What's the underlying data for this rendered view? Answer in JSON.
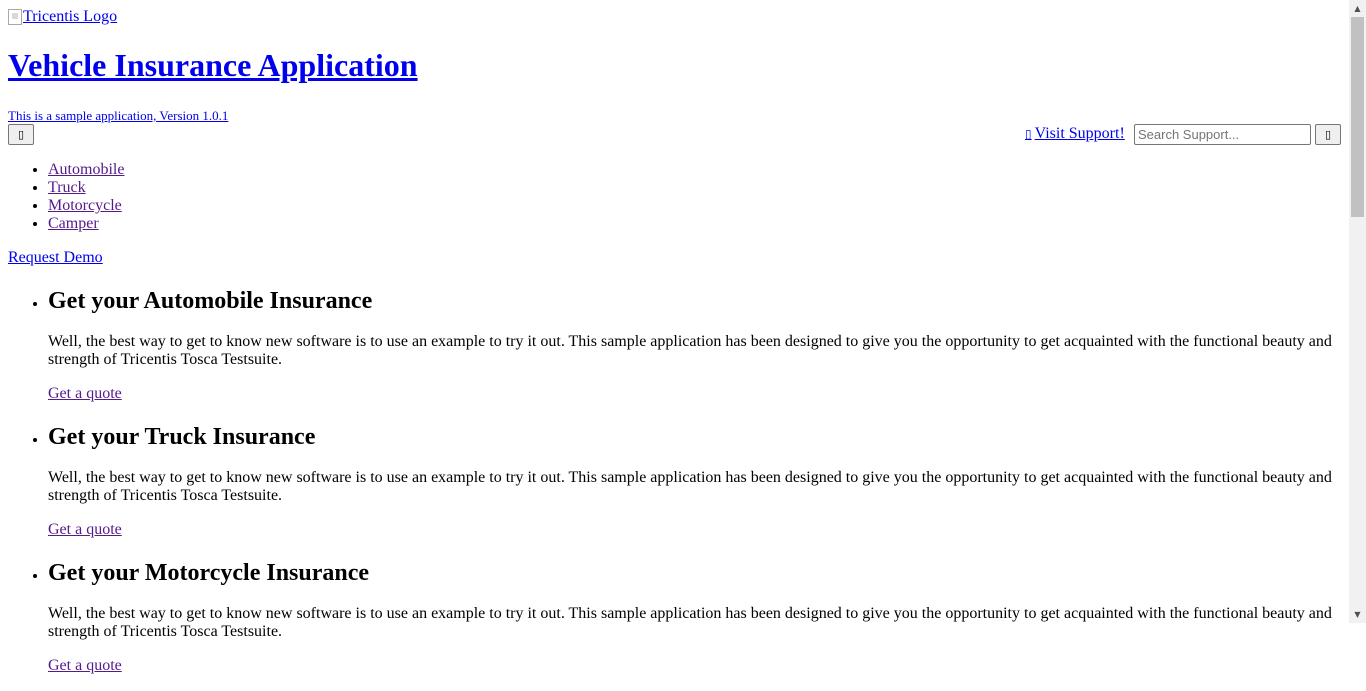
{
  "header": {
    "logo_alt": "Tricentis Logo",
    "app_title": "Vehicle Insurance Application",
    "version_text": "This is a sample application, Version 1.0.1",
    "menu_button_glyph": "▯",
    "support": {
      "glyph": "▯",
      "link_label": "Visit Support!",
      "search_placeholder": "Search Support...",
      "search_value": "",
      "search_button_glyph": "▯"
    }
  },
  "nav": {
    "items": [
      {
        "label": "Automobile"
      },
      {
        "label": "Truck"
      },
      {
        "label": "Motorcycle"
      },
      {
        "label": "Camper"
      }
    ]
  },
  "request_demo_label": "Request Demo",
  "products": [
    {
      "title": "Get your Automobile Insurance",
      "description": "Well, the best way to get to know new software is to use an example to try it out. This sample application has been designed to give you the opportunity to get acquainted with the functional beauty and strength of Tricentis Tosca Testsuite.",
      "cta_label": "Get a quote"
    },
    {
      "title": "Get your Truck Insurance",
      "description": "Well, the best way to get to know new software is to use an example to try it out. This sample application has been designed to give you the opportunity to get acquainted with the functional beauty and strength of Tricentis Tosca Testsuite.",
      "cta_label": "Get a quote"
    },
    {
      "title": "Get your Motorcycle Insurance",
      "description": "Well, the best way to get to know new software is to use an example to try it out. This sample application has been designed to give you the opportunity to get acquainted with the functional beauty and strength of Tricentis Tosca Testsuite.",
      "cta_label": "Get a quote"
    }
  ],
  "scrollbar": {
    "up_glyph": "▲",
    "down_glyph": "▼"
  },
  "colors": {
    "link": "#0000ee",
    "visited_link": "#551a8b",
    "background": "#ffffff"
  }
}
